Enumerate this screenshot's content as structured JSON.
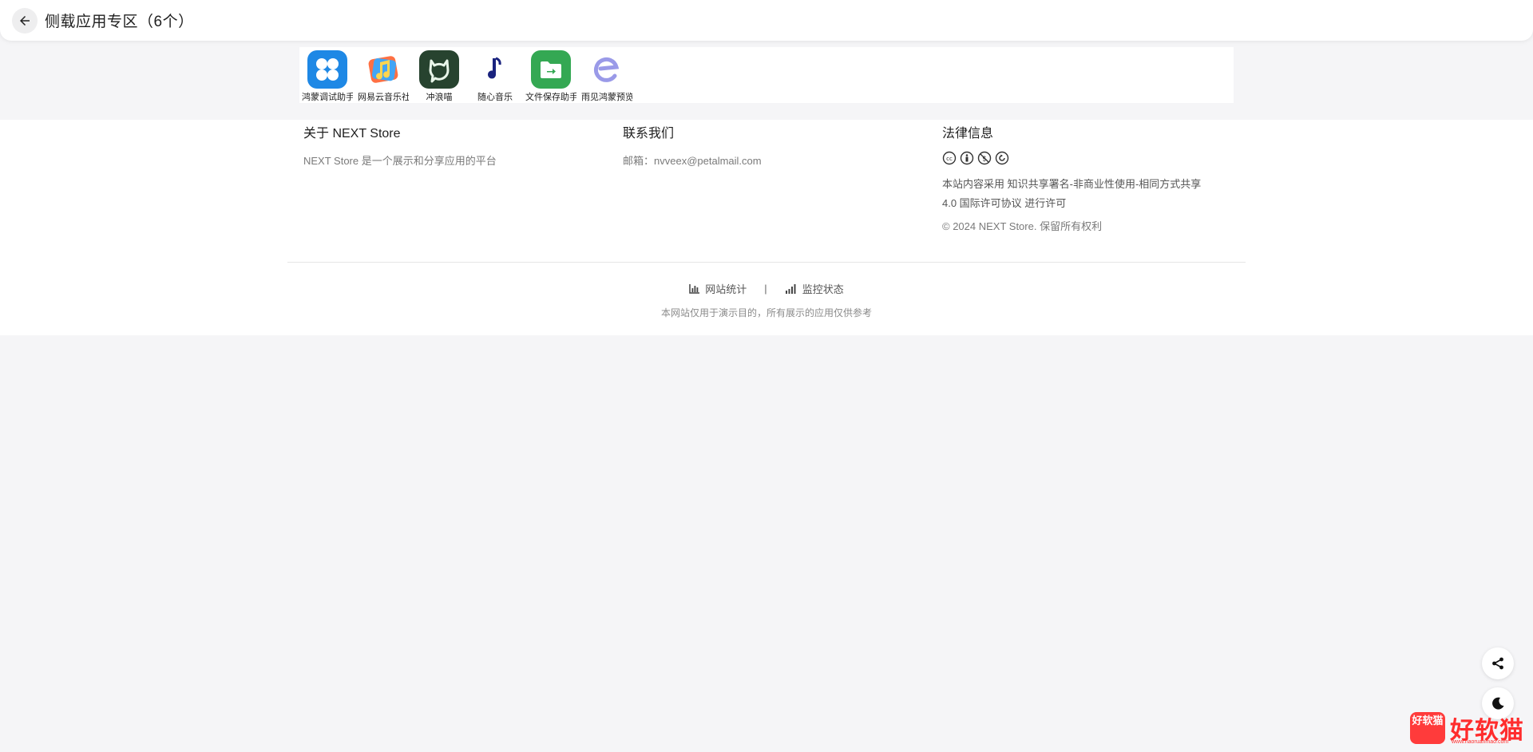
{
  "header": {
    "title": "侧载应用专区（6个）"
  },
  "apps": [
    {
      "name": "鸿蒙调试助手",
      "icon": "clover-grid-icon",
      "color": "#1e88e5"
    },
    {
      "name": "网易云音乐社区",
      "icon": "music-note-colorful-icon",
      "color": "#e53935"
    },
    {
      "name": "冲浪喵",
      "icon": "cat-icon",
      "color": "#27432f"
    },
    {
      "name": "随心音乐",
      "icon": "music-note-icon",
      "color": "#1a237e"
    },
    {
      "name": "文件保存助手",
      "icon": "folder-arrow-icon",
      "color": "#34a853"
    },
    {
      "name": "雨见鸿蒙预览",
      "icon": "letter-e-icon",
      "color": "#8e8ee8"
    }
  ],
  "footer": {
    "about": {
      "title": "关于 NEXT Store",
      "text": "NEXT Store 是一个展示和分享应用的平台"
    },
    "contact": {
      "title": "联系我们",
      "email": "邮箱：nvveex@petalmail.com"
    },
    "legal": {
      "title": "法律信息",
      "license_line1": "本站内容采用 知识共享署名-非商业性使用-相同方式共享",
      "license_line2": "4.0 国际许可协议 进行许可",
      "copyright": "© 2024 NEXT Store. 保留所有权利"
    },
    "links": {
      "stats": "网站统计",
      "separator": "|",
      "monitor": "监控状态"
    },
    "disclaimer": "本网站仅用于演示目的，所有展示的应用仅供参考"
  },
  "watermark": {
    "badge": "好软猫",
    "text": "好软猫",
    "sub": "www.haoruanmao.com"
  }
}
